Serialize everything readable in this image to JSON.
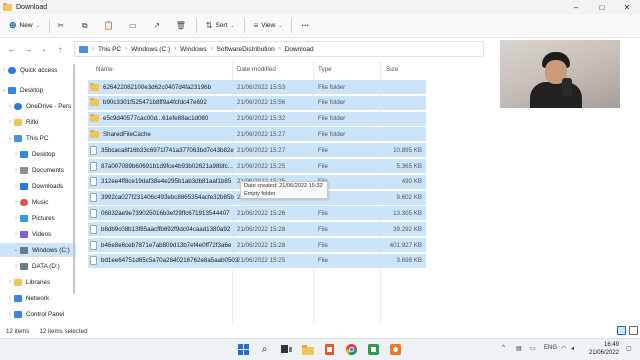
{
  "window": {
    "title": "Download",
    "controls": {
      "minimize": "–",
      "maximize": "□",
      "close": "✕"
    }
  },
  "toolbar": {
    "new_label": "New",
    "sort_label": "Sort",
    "view_label": "View",
    "more_label": "···"
  },
  "breadcrumb": [
    "This PC",
    "Windows (C:)",
    "Windows",
    "SoftwareDistribution",
    "Download"
  ],
  "sidebar": {
    "items": [
      {
        "label": "Quick access",
        "color": "#2d7bd6"
      },
      {
        "label": "Desktop",
        "color": "#3b86d8"
      },
      {
        "label": "OneDrive - Pers",
        "color": "#2d7bd6"
      },
      {
        "label": "Rifki",
        "color": "#f2c55c"
      },
      {
        "label": "This PC",
        "color": "#4a90d9"
      },
      {
        "label": "Desktop",
        "color": "#3b86d8"
      },
      {
        "label": "Documents",
        "color": "#8a8f97"
      },
      {
        "label": "Downloads",
        "color": "#2d7bd6"
      },
      {
        "label": "Music",
        "color": "#d9534f"
      },
      {
        "label": "Pictures",
        "color": "#3b9ad9"
      },
      {
        "label": "Videos",
        "color": "#8e5bd6"
      },
      {
        "label": "Windows (C:)",
        "color": "#6b7b8c"
      },
      {
        "label": "DATA (D:)",
        "color": "#6b7b8c"
      },
      {
        "label": "Libraries",
        "color": "#f2c55c"
      },
      {
        "label": "Network",
        "color": "#3b86d8"
      },
      {
        "label": "Control Panel",
        "color": "#3b86d8"
      }
    ]
  },
  "columns": {
    "name": "Name",
    "date": "Date modified",
    "type": "Type",
    "size": "Size"
  },
  "files": [
    {
      "name": "626422082100e3d62c0407d4fa23196b",
      "date": "21/06/2022 15:53",
      "type": "File folder",
      "size": "",
      "kind": "folder"
    },
    {
      "name": "b90c3301f525471b8ff9a4fcfdc47e692",
      "date": "21/06/2022 15:56",
      "type": "File folder",
      "size": "",
      "kind": "folder"
    },
    {
      "name": "e5c9d40577cac00d...61efe88ac1d080",
      "date": "21/06/2022 15:32",
      "type": "File folder",
      "size": "",
      "kind": "folder"
    },
    {
      "name": "SharedFileCache",
      "date": "21/06/2022 15:27",
      "type": "File folder",
      "size": "",
      "kind": "folder"
    },
    {
      "name": "35bcaca8f16b33c6971f741a377063bd7c43b82e",
      "date": "21/06/2022 15:27",
      "type": "File",
      "size": "10.895 KB",
      "kind": "file"
    },
    {
      "name": "87a007089b60691b1d9fce4b93b02621a98bfc...",
      "date": "21/06/2022 15:25",
      "type": "File",
      "size": "5.365 KB",
      "kind": "file"
    },
    {
      "name": "312ee4ff8ce19daf38e4e295b1ab3db81aaf1b85",
      "date": "21/06/2022 15:25",
      "type": "File",
      "size": "490 KB",
      "kind": "file"
    },
    {
      "name": "3992ca027f231406c493ebc8865354acfe32b85b",
      "date": "21/06/2022 15:25",
      "type": "File",
      "size": "9.602 KB",
      "kind": "file"
    },
    {
      "name": "06032ae9e739025016b3ef29ffc671913544407",
      "date": "21/06/2022 15:26",
      "type": "File",
      "size": "13.305 KB",
      "kind": "file"
    },
    {
      "name": "b8db9c08b13f85aacffb692f9dc04caad1380a92",
      "date": "21/06/2022 15:28",
      "type": "File",
      "size": "39.292 KB",
      "kind": "file"
    },
    {
      "name": "b46e8e6ceb7871e7ab809d13b7ef4e0ff72f3a6e",
      "date": "21/06/2022 15:28",
      "type": "File",
      "size": "401.927 KB",
      "kind": "file"
    },
    {
      "name": "bd1ee64751d65c5a70a2840216762e8a5aab0503",
      "date": "21/06/2022 15:25",
      "type": "File",
      "size": "3.698 KB",
      "kind": "file"
    }
  ],
  "tooltip": {
    "line1": "Date created: 21/06/2022 15:32",
    "line2": "Empty folder"
  },
  "status": {
    "count": "12 items",
    "selected": "12 items selected"
  },
  "taskbar": {
    "clock_time": "16:49",
    "clock_date": "21/06/2022",
    "tray_lang": "ENG"
  }
}
